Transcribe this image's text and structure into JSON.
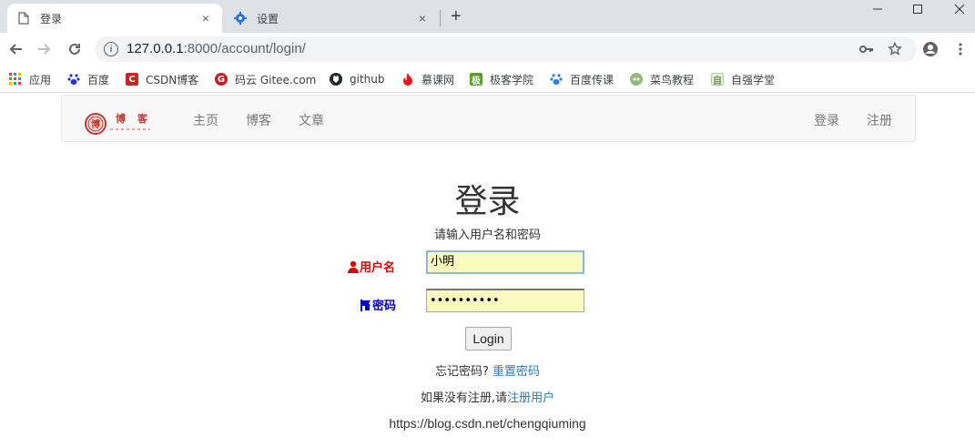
{
  "browser": {
    "tabs": [
      {
        "title": "登录",
        "icon": "page-icon",
        "close": "×"
      },
      {
        "title": "设置",
        "icon": "gear-icon",
        "close": "×"
      }
    ],
    "new_tab": "+",
    "window_controls": {
      "minimize": "—",
      "maximize": "☐",
      "close": "✕"
    },
    "url_host": "127.0.0.1",
    "url_path": ":8000/account/login/"
  },
  "bookmarks": [
    {
      "label": "应用",
      "icon": "apps-icon",
      "color": "#e94335"
    },
    {
      "label": "百度",
      "icon": "baidu-paw-icon",
      "color": "#2932e1"
    },
    {
      "label": "CSDN博客",
      "icon": "csdn-icon",
      "color": "#c3271f"
    },
    {
      "label": "码云 Gitee.com",
      "icon": "gitee-icon",
      "color": "#c71d23"
    },
    {
      "label": "github",
      "icon": "github-icon",
      "color": "#24292e"
    },
    {
      "label": "慕课网",
      "icon": "flame-icon",
      "color": "#f01414"
    },
    {
      "label": "极客学院",
      "icon": "jikexueyuan-icon",
      "color": "#5aa025"
    },
    {
      "label": "百度传课",
      "icon": "baidu-paw-icon",
      "color": "#2d7ee8"
    },
    {
      "label": "菜鸟教程",
      "icon": "runoob-icon",
      "color": "#96b97d"
    },
    {
      "label": "自强学堂",
      "icon": "ziqiang-icon",
      "color": "#6f8d5a"
    }
  ],
  "site": {
    "brand": "博 客",
    "brand_color": "#c0392b",
    "nav": {
      "home": "主页",
      "blog": "博客",
      "article": "文章"
    },
    "nav_right": {
      "login": "登录",
      "register": "注册"
    }
  },
  "login": {
    "heading": "登录",
    "subtitle": "请输入用户名和密码",
    "username_label": "用户名",
    "username_value": "小明",
    "password_label": "密码",
    "password_value": "••••••••••",
    "submit": "Login",
    "forgot_text": "忘记密码?",
    "reset_link": "重置密码",
    "register_text": "如果没有注册,请",
    "register_link": "注册用户",
    "source_note": "https://blog.csdn.net/chengqiuming"
  }
}
